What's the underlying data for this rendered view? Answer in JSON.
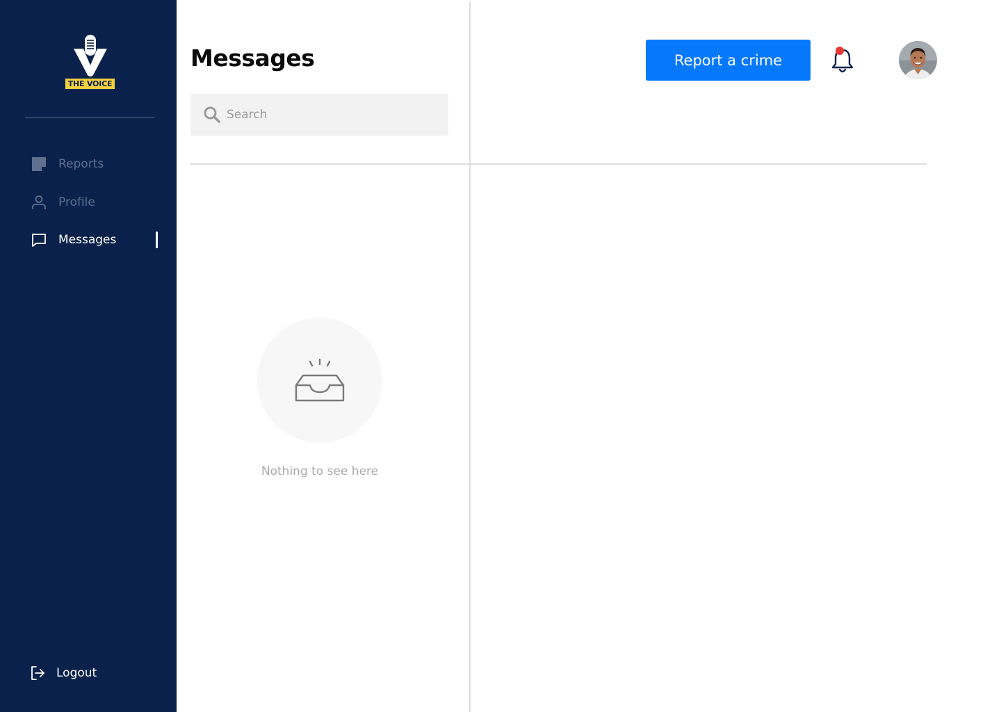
{
  "brand": {
    "name": "THE VOICE"
  },
  "sidebar": {
    "items": [
      {
        "label": "Reports",
        "icon": "note-icon",
        "active": false
      },
      {
        "label": "Profile",
        "icon": "user-icon",
        "active": false
      },
      {
        "label": "Messages",
        "icon": "chat-icon",
        "active": true
      }
    ],
    "logout": {
      "label": "Logout",
      "icon": "logout-icon"
    }
  },
  "main": {
    "title": "Messages",
    "search": {
      "placeholder": "Search",
      "value": ""
    },
    "empty_state": {
      "text": "Nothing to see here",
      "icon": "empty-inbox-icon"
    }
  },
  "header": {
    "report_button": "Report a crime",
    "notifications": {
      "icon": "bell-icon",
      "has_unread": true
    },
    "avatar": {
      "icon": "user-avatar"
    }
  },
  "colors": {
    "sidebar_bg": "#0a224b",
    "accent": "#0678fc",
    "brand_yellow": "#f4d03f",
    "notification_dot": "#e53935"
  }
}
